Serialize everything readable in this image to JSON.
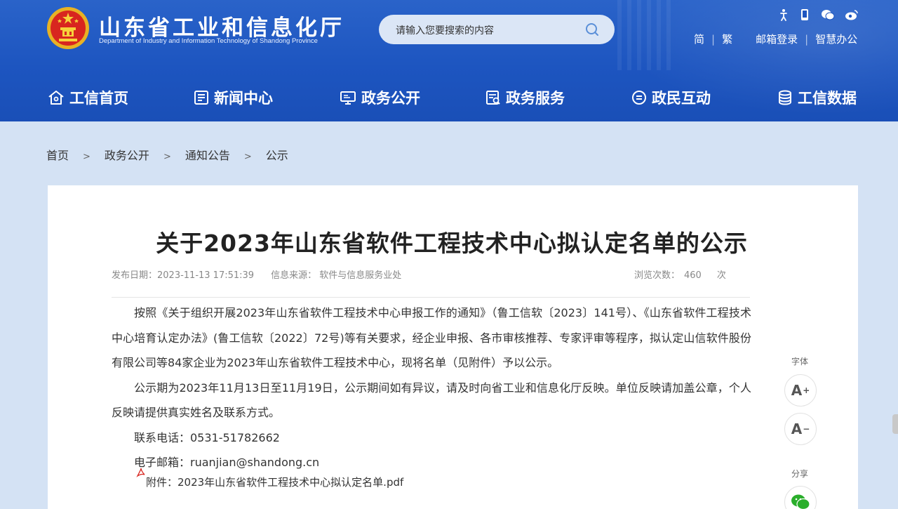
{
  "header": {
    "site_title": "山东省工业和信息化厅",
    "site_subtitle": "Department of Industry and Information Technology of Shandong Province",
    "search_placeholder": "请输入您要搜索的内容",
    "top_icons": [
      "accessibility-icon",
      "mobile-icon",
      "wechat-icon",
      "weibo-icon"
    ],
    "top_links": {
      "simplified": "简",
      "traditional": "繁",
      "mail_login": "邮箱登录",
      "smart_office": "智慧办公"
    },
    "nav": [
      {
        "label": "工信首页",
        "icon": "home-icon"
      },
      {
        "label": "新闻中心",
        "icon": "news-icon"
      },
      {
        "label": "政务公开",
        "icon": "monitor-icon"
      },
      {
        "label": "政务服务",
        "icon": "service-icon"
      },
      {
        "label": "政民互动",
        "icon": "chat-icon"
      },
      {
        "label": "工信数据",
        "icon": "database-icon"
      }
    ],
    "colors": {
      "header_bg": "#1d55c0",
      "page_bg": "#d4e2f4"
    }
  },
  "breadcrumb": {
    "items": [
      "首页",
      "政务公开",
      "通知公告",
      "公示"
    ],
    "separator": ">"
  },
  "article": {
    "title": "关于2023年山东省软件工程技术中心拟认定名单的公示",
    "publish_date": "发布日期：2023-11-13 17:51:39",
    "source": "信息来源： 软件与信息服务业处",
    "views_label": "浏览次数：",
    "views_count": "460",
    "views_unit": "次",
    "paragraphs": [
      "按照《关于组织开展2023年山东省软件工程技术中心申报工作的通知》（鲁工信软〔2023〕141号）、《山东省软件工程技术中心培育认定办法》(鲁工信软〔2022〕72号)等有关要求，经企业申报、各市审核推荐、专家评审等程序，拟认定山信软件股份有限公司等84家企业为2023年山东省软件工程技术中心，现将名单（见附件）予以公示。",
      "公示期为2023年11月13日至11月19日，公示期间如有异议，请及时向省工业和信息化厅反映。单位反映请加盖公章，个人反映请提供真实姓名及联系方式。",
      "联系电话：0531-51782662",
      "电子邮箱：ruanjian@shandong.cn"
    ],
    "attachment": "附件：2023年山东省软件工程技术中心拟认定名单.pdf"
  },
  "side_tools": {
    "font_label": "字体",
    "font_increase": "A",
    "font_decrease": "A",
    "share_label": "分享"
  }
}
